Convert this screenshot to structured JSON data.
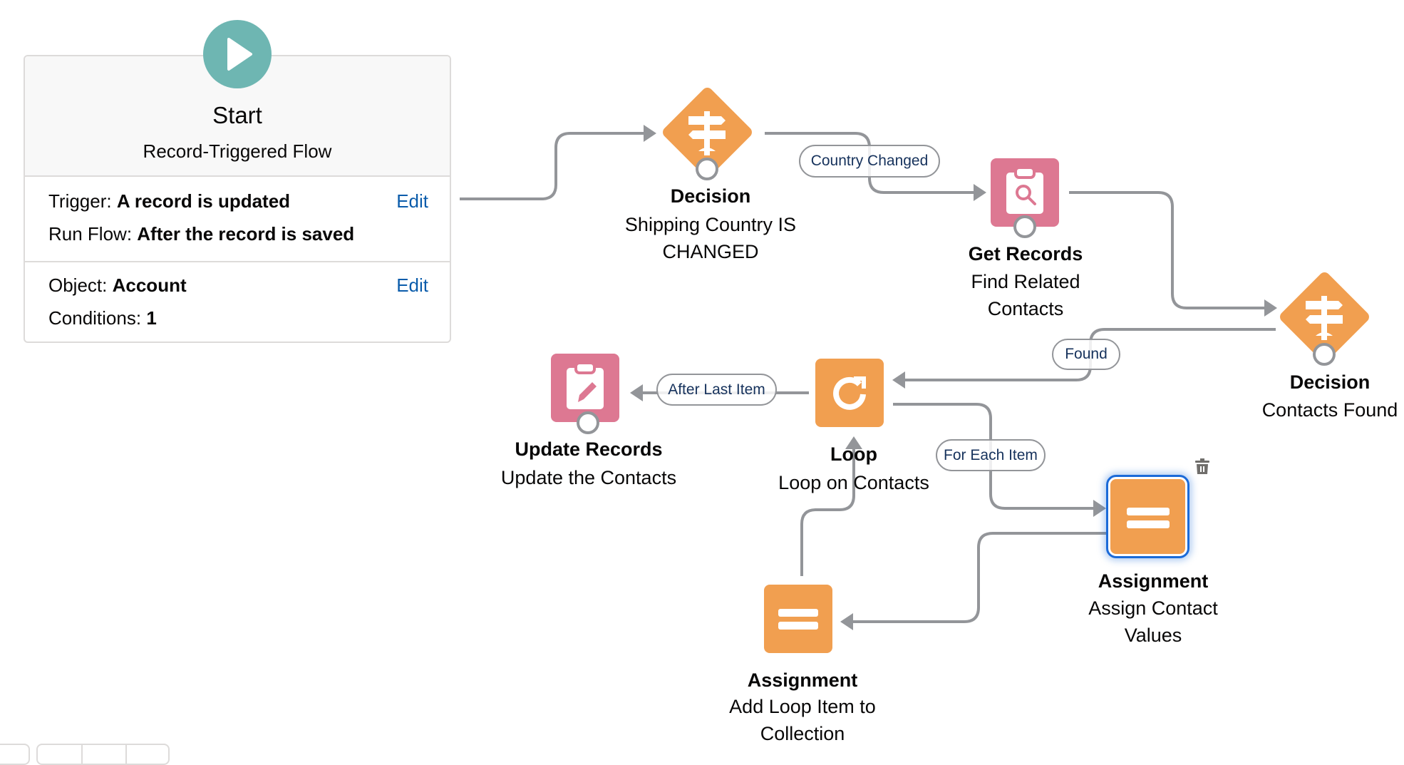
{
  "start": {
    "title": "Start",
    "subtitle": "Record-Triggered Flow",
    "icon": "play-icon",
    "trigger_label": "Trigger:",
    "trigger_value": "A record is updated",
    "run_flow_label": "Run Flow:",
    "run_flow_value": "After the record is saved",
    "object_label": "Object:",
    "object_value": "Account",
    "conditions_label": "Conditions:",
    "conditions_value": "1",
    "edit_trigger_label": "Edit",
    "edit_object_label": "Edit"
  },
  "nodes": {
    "decision1": {
      "type": "Decision",
      "label_lines": [
        "Shipping Country IS",
        "CHANGED"
      ],
      "icon": "signpost-icon",
      "color": "#f19f50"
    },
    "get_records": {
      "type": "Get Records",
      "label_lines": [
        "Find Related",
        "Contacts"
      ],
      "icon": "clipboard-search-icon",
      "color": "#dd7892"
    },
    "decision2": {
      "type": "Decision",
      "label_lines": [
        "Contacts Found"
      ],
      "icon": "signpost-icon",
      "color": "#f19f50"
    },
    "loop": {
      "type": "Loop",
      "label_lines": [
        "Loop on Contacts"
      ],
      "icon": "loop-icon",
      "color": "#f19f50"
    },
    "update_records": {
      "type": "Update Records",
      "label_lines": [
        "Update the Contacts"
      ],
      "icon": "clipboard-edit-icon",
      "color": "#dd7892"
    },
    "assign_contact": {
      "type": "Assignment",
      "label_lines": [
        "Assign Contact",
        "Values"
      ],
      "icon": "equals-icon",
      "color": "#f19f50",
      "selected": true
    },
    "assign_collection": {
      "type": "Assignment",
      "label_lines": [
        "Add Loop Item to",
        "Collection"
      ],
      "icon": "equals-icon",
      "color": "#f19f50"
    }
  },
  "connector_labels": {
    "country_changed": "Country Changed",
    "found": "Found",
    "after_last_item": "After Last Item",
    "for_each_item": "For Each Item"
  },
  "colors": {
    "accent_teal": "#6eb6b2",
    "link_blue": "#0b5cab",
    "selection_blue": "#1b6ad8",
    "connector_gray": "#939599"
  }
}
